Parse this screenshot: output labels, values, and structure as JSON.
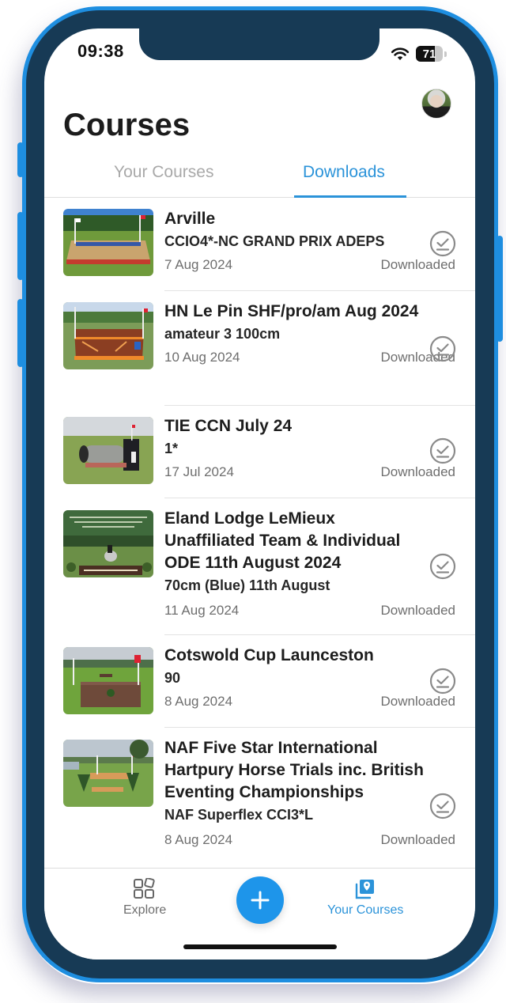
{
  "status_bar": {
    "time": "09:38",
    "battery_percent": 71,
    "battery_label": "71"
  },
  "header": {
    "title": "Courses"
  },
  "tabs": [
    {
      "label": "Your Courses",
      "active": false
    },
    {
      "label": "Downloads",
      "active": true
    }
  ],
  "courses": [
    {
      "title": "Arville",
      "subtitle": "CCIO4*-NC GRAND PRIX ADEPS",
      "date": "7 Aug 2024",
      "status": "Downloaded",
      "icon": "download-check-icon"
    },
    {
      "title": "HN Le Pin SHF/pro/am Aug 2024",
      "subtitle": "amateur 3 100cm",
      "date": "10 Aug 2024",
      "status": "Downloaded",
      "icon": "download-check-icon"
    },
    {
      "title": "TIE CCN July 24",
      "subtitle": "1*",
      "date": "17 Jul 2024",
      "status": "Downloaded",
      "icon": "download-check-icon"
    },
    {
      "title": "Eland Lodge LeMieux Unaffiliated Team & Individual ODE 11th August 2024",
      "subtitle": "70cm (Blue) 11th August",
      "date": "11 Aug 2024",
      "status": "Downloaded",
      "icon": "download-check-icon"
    },
    {
      "title": "Cotswold Cup Launceston",
      "subtitle": "90",
      "date": "8 Aug 2024",
      "status": "Downloaded",
      "icon": "download-check-icon"
    },
    {
      "title": "NAF Five Star International Hartpury Horse Trials inc. British Eventing Championships",
      "subtitle": "NAF Superflex CCI3*L",
      "date": "8 Aug 2024",
      "status": "Downloaded",
      "icon": "download-check-icon"
    }
  ],
  "bottom_nav": {
    "explore_label": "Explore",
    "add_icon": "plus-icon",
    "your_courses_label": "Your Courses"
  },
  "colors": {
    "accent": "#2b93d9",
    "fab": "#1e95ea",
    "frame": "#1e8ee0",
    "bezel": "#173a55",
    "inactive": "#a9a9a9"
  }
}
